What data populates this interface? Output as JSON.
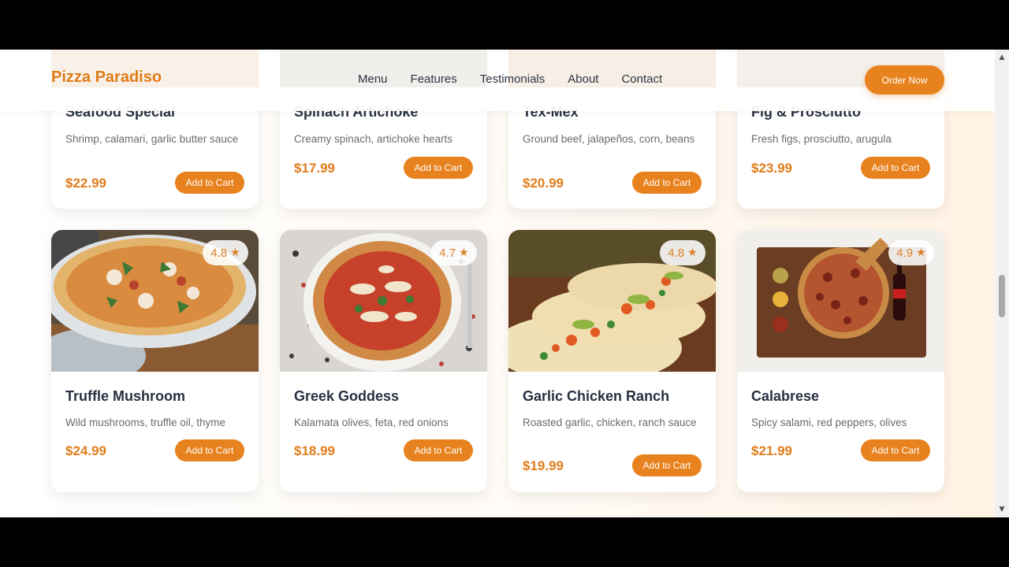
{
  "brand": {
    "name": "Pizza Paradiso",
    "accent": "#e8821e"
  },
  "nav": {
    "links": [
      "Menu",
      "Features",
      "Testimonials",
      "About",
      "Contact"
    ],
    "order_label": "Order Now"
  },
  "top_row": [
    {
      "title": "Seafood Special",
      "desc": "Shrimp, calamari, garlic butter sauce",
      "price": "$22.99",
      "cart": "Add to Cart"
    },
    {
      "title": "Spinach Artichoke",
      "desc": "Creamy spinach, artichoke hearts",
      "price": "$17.99",
      "cart": "Add to Cart"
    },
    {
      "title": "Tex-Mex",
      "desc": "Ground beef, jalapeños, corn, beans",
      "price": "$20.99",
      "cart": "Add to Cart"
    },
    {
      "title": "Fig & Prosciutto",
      "desc": "Fresh figs, prosciutto, arugula",
      "price": "$23.99",
      "cart": "Add to Cart"
    }
  ],
  "bottom_row": [
    {
      "title": "Truffle Mushroom",
      "desc": "Wild mushrooms, truffle oil, thyme",
      "price": "$24.99",
      "cart": "Add to Cart",
      "rating": "4.8"
    },
    {
      "title": "Greek Goddess",
      "desc": "Kalamata olives, feta, red onions",
      "price": "$18.99",
      "cart": "Add to Cart",
      "rating": "4.7"
    },
    {
      "title": "Garlic Chicken Ranch",
      "desc": "Roasted garlic, chicken, ranch sauce",
      "price": "$19.99",
      "cart": "Add to Cart",
      "rating": "4.8"
    },
    {
      "title": "Calabrese",
      "desc": "Spicy salami, red peppers, olives",
      "price": "$21.99",
      "cart": "Add to Cart",
      "rating": "4.9"
    }
  ],
  "icons": {
    "rating": "star-icon",
    "scroll_up": "arrow-up-icon",
    "scroll_down": "arrow-down-icon"
  }
}
